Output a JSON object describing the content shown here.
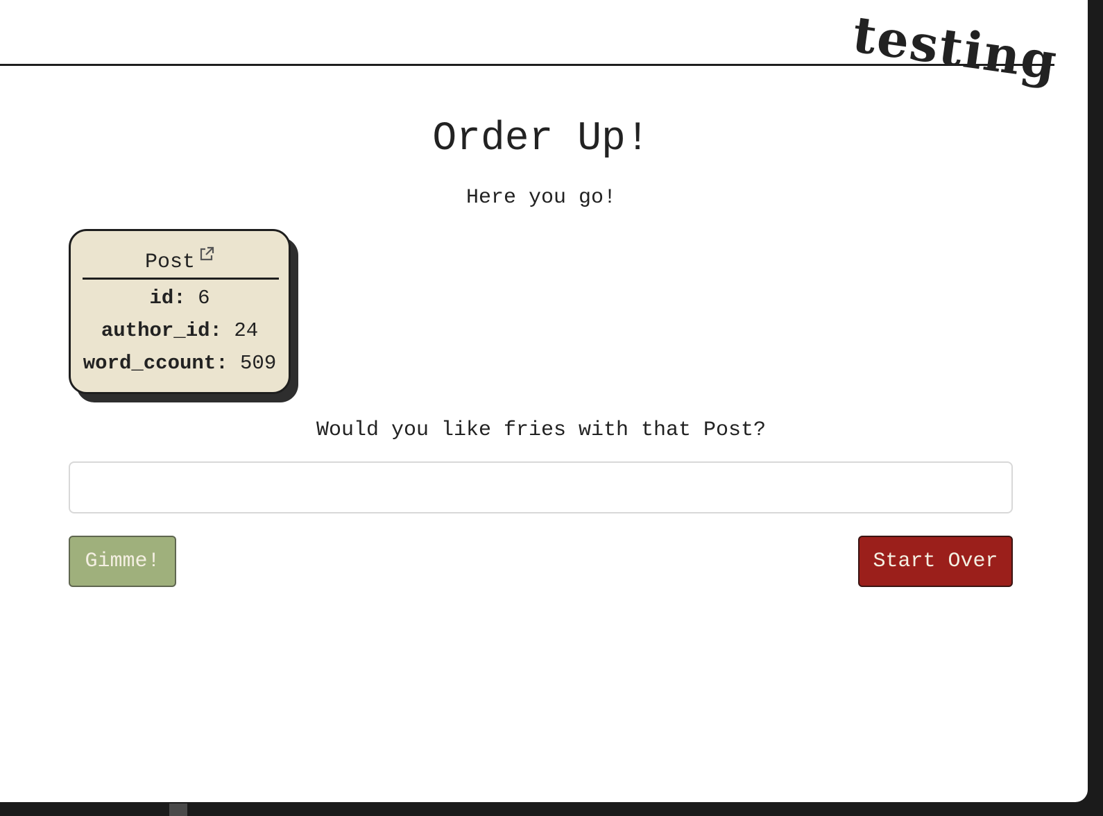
{
  "header": {
    "brand": "testing"
  },
  "main": {
    "title": "Order Up!",
    "subtitle": "Here you go!",
    "card": {
      "title": "Post",
      "icon": "external-link-icon",
      "fields": [
        {
          "key": "id:",
          "value": "6"
        },
        {
          "key": "author_id:",
          "value": "24"
        },
        {
          "key": "word_ccount:",
          "value": "509"
        }
      ]
    },
    "question": "Would you like fries with that Post?",
    "input": {
      "value": "",
      "placeholder": ""
    },
    "buttons": {
      "gimme": "Gimme!",
      "start_over": "Start Over"
    }
  },
  "colors": {
    "card_background": "#ebe4cf",
    "gimme_button": "#9fb07c",
    "start_over_button": "#9b1f1b",
    "ink": "#222222"
  }
}
